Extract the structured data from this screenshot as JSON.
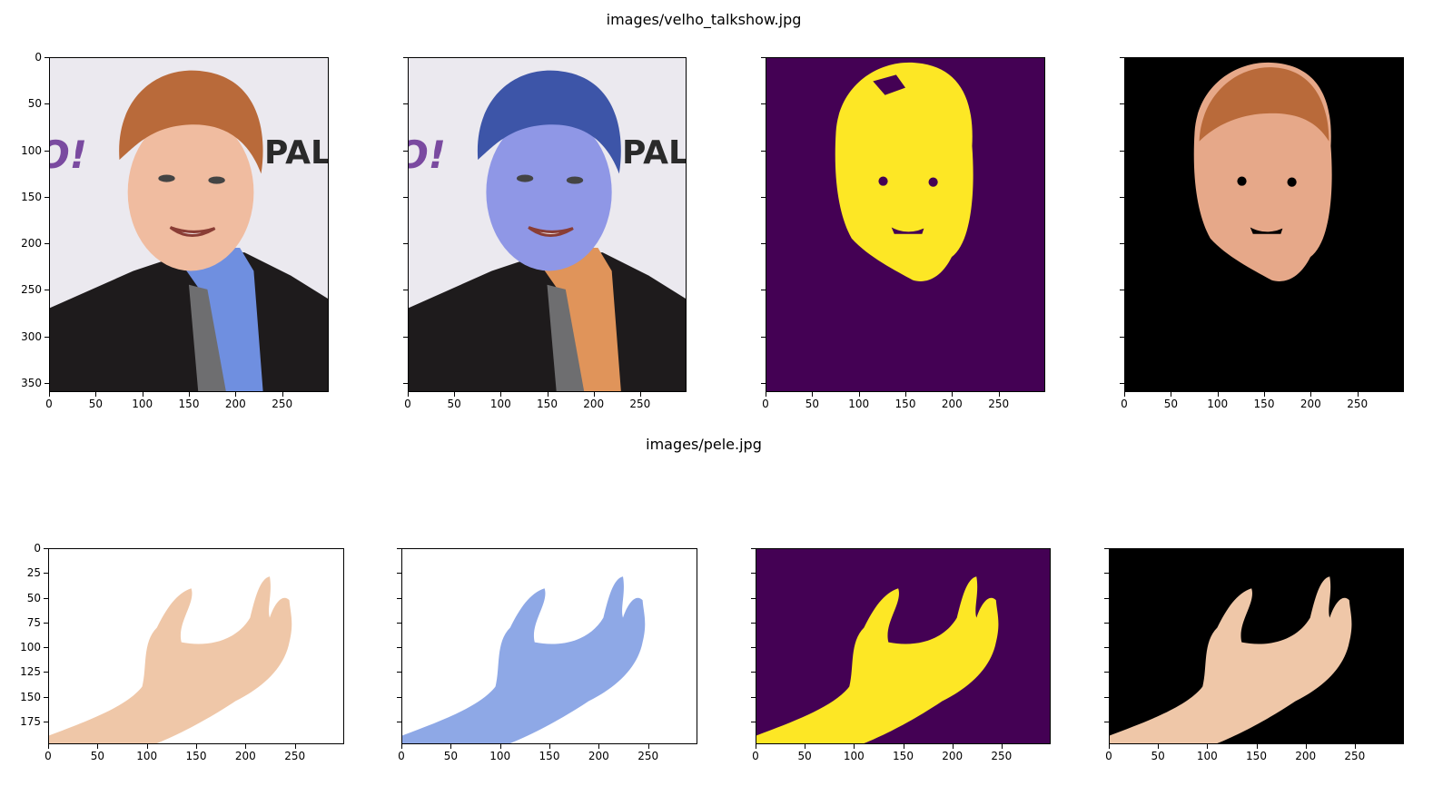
{
  "rows": [
    {
      "title": "images/velho_talkshow.jpg"
    },
    {
      "title": "images/pele.jpg"
    }
  ],
  "chart_data": [
    {
      "type": "image",
      "row": 0,
      "col": 0,
      "content": "original photo: man in suit with blue shirt and patterned tie, logo text at right",
      "background_text": [
        "O!",
        "PAL"
      ],
      "x_ticks": [
        0,
        50,
        100,
        150,
        200,
        250
      ],
      "y_ticks": [
        0,
        50,
        100,
        150,
        200,
        250,
        300,
        350
      ],
      "xlim": [
        0,
        300
      ],
      "ylim": [
        360,
        0
      ],
      "show_y_tick_labels": true
    },
    {
      "type": "image",
      "row": 0,
      "col": 1,
      "content": "same photo with color channels swapped (bluish skin, orange shirt)",
      "background_text": [
        "O!",
        "PAL"
      ],
      "x_ticks": [
        0,
        50,
        100,
        150,
        200,
        250
      ],
      "y_ticks": [
        0,
        50,
        100,
        150,
        200,
        250,
        300,
        350
      ],
      "xlim": [
        0,
        300
      ],
      "ylim": [
        360,
        0
      ],
      "show_y_tick_labels": false
    },
    {
      "type": "heatmap",
      "row": 0,
      "col": 2,
      "content": "binary skin mask (viridis): yellow face region on purple background",
      "colors": {
        "background": "#440154",
        "foreground": "#fde725"
      },
      "x_ticks": [
        0,
        50,
        100,
        150,
        200,
        250
      ],
      "y_ticks": [
        0,
        50,
        100,
        150,
        200,
        250,
        300,
        350
      ],
      "xlim": [
        0,
        300
      ],
      "ylim": [
        360,
        0
      ],
      "show_y_tick_labels": false
    },
    {
      "type": "image",
      "row": 0,
      "col": 3,
      "content": "masked photo: only skin-colored face pixels on black",
      "x_ticks": [
        0,
        50,
        100,
        150,
        200,
        250
      ],
      "y_ticks": [
        0,
        50,
        100,
        150,
        200,
        250,
        300,
        350
      ],
      "xlim": [
        0,
        300
      ],
      "ylim": [
        360,
        0
      ],
      "show_y_tick_labels": false
    },
    {
      "type": "image",
      "row": 1,
      "col": 0,
      "content": "original photo: open hand reaching right on white background",
      "x_ticks": [
        0,
        50,
        100,
        150,
        200,
        250
      ],
      "y_ticks": [
        0,
        25,
        50,
        75,
        100,
        125,
        150,
        175
      ],
      "xlim": [
        0,
        300
      ],
      "ylim": [
        198,
        0
      ],
      "show_y_tick_labels": true
    },
    {
      "type": "image",
      "row": 1,
      "col": 1,
      "content": "same hand photo with color channels swapped (bluish)",
      "x_ticks": [
        0,
        50,
        100,
        150,
        200,
        250
      ],
      "y_ticks": [
        0,
        25,
        50,
        75,
        100,
        125,
        150,
        175
      ],
      "xlim": [
        0,
        300
      ],
      "ylim": [
        198,
        0
      ],
      "show_y_tick_labels": false
    },
    {
      "type": "heatmap",
      "row": 1,
      "col": 2,
      "content": "binary skin mask (viridis): yellow hand on purple background",
      "colors": {
        "background": "#440154",
        "foreground": "#fde725"
      },
      "x_ticks": [
        0,
        50,
        100,
        150,
        200,
        250
      ],
      "y_ticks": [
        0,
        25,
        50,
        75,
        100,
        125,
        150,
        175
      ],
      "xlim": [
        0,
        300
      ],
      "ylim": [
        198,
        0
      ],
      "show_y_tick_labels": false
    },
    {
      "type": "image",
      "row": 1,
      "col": 3,
      "content": "masked photo: only hand pixels on black",
      "x_ticks": [
        0,
        50,
        100,
        150,
        200,
        250
      ],
      "y_ticks": [
        0,
        25,
        50,
        75,
        100,
        125,
        150,
        175
      ],
      "xlim": [
        0,
        300
      ],
      "ylim": [
        198,
        0
      ],
      "show_y_tick_labels": false
    }
  ]
}
